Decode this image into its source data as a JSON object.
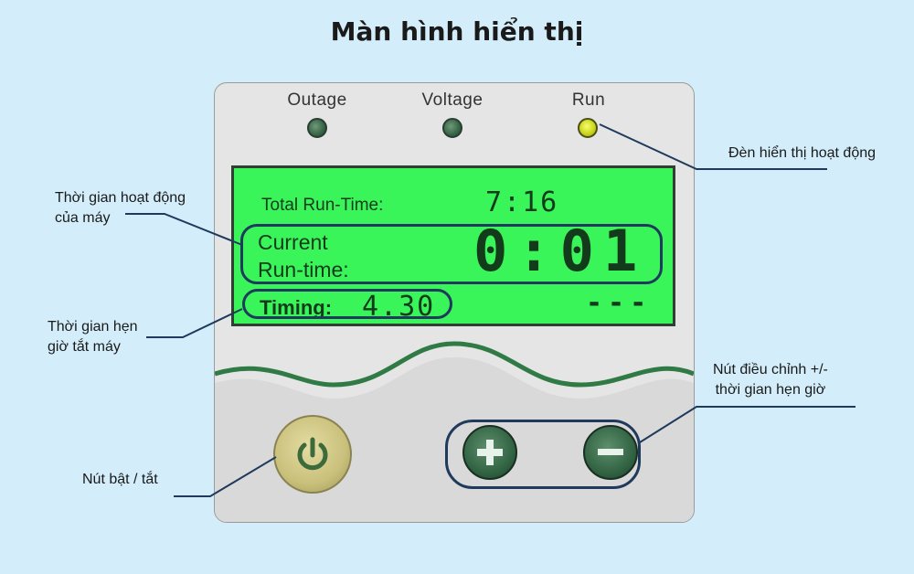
{
  "title": "Màn hình hiển thị",
  "leds": {
    "outage": "Outage",
    "voltage": "Voltage",
    "run": "Run"
  },
  "lcd": {
    "total_label": "Total Run-Time:",
    "total_value": "7:16",
    "current_label_1": "Current",
    "current_label_2": "Run-time:",
    "current_value": "0:01",
    "timing_label": "Timing:",
    "timing_value": "4.30",
    "timing_right": "---"
  },
  "callouts": {
    "run_light": "Đèn hiển thị hoạt động",
    "runtime_1": "Thời gian hoạt động",
    "runtime_2": "của máy",
    "timer_1": "Thời gian hẹn",
    "timer_2": "giờ tắt máy",
    "adjust_1": "Nút điều chỉnh +/-",
    "adjust_2": "thời gian hẹn giờ",
    "power": "Nút bật / tắt"
  },
  "colors": {
    "background": "#d3eefa",
    "lcd": "#39f55a",
    "highlight": "#1f3a5c",
    "led_on": "#d8e22a"
  }
}
